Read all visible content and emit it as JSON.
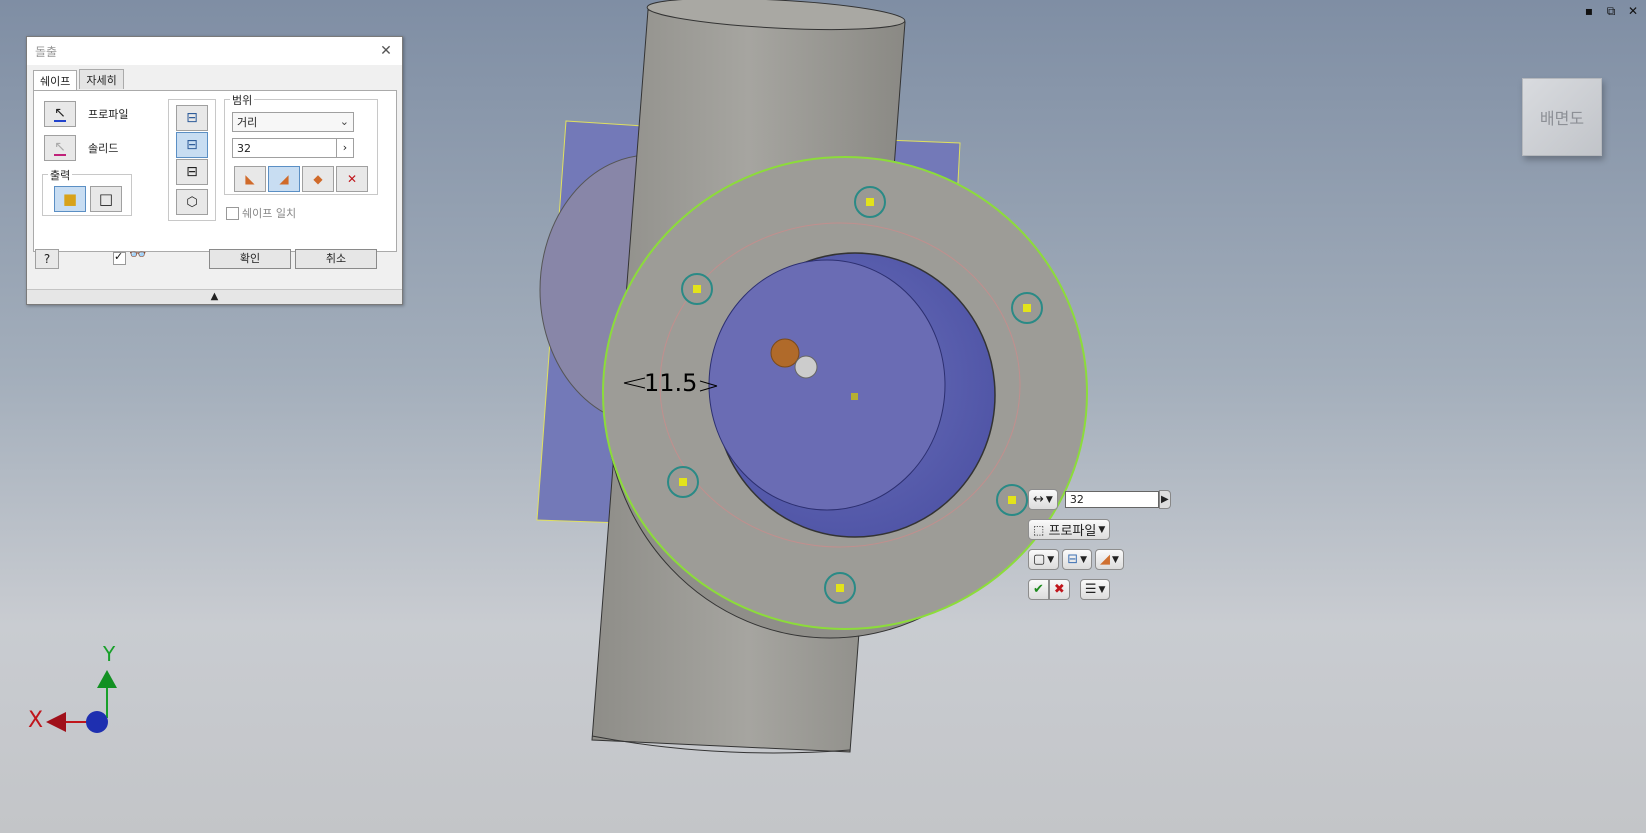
{
  "window_controls": {
    "minimize": "▪",
    "restore": "⧉",
    "close": "✕"
  },
  "dialog": {
    "title": "돌출",
    "close": "✕",
    "tabs": [
      {
        "label": "쉐이프"
      },
      {
        "label": "자세히"
      }
    ],
    "profile_label": "프로파일",
    "solid_label": "솔리드",
    "output_group": "출력",
    "extent_group": "범위",
    "extent_type": "거리",
    "distance_value": "32",
    "match_shape_label": "쉐이프 일치",
    "ok_button": "확인",
    "cancel_button": "취소",
    "expand_arrow": "▲"
  },
  "canvas": {
    "dimension_text": "11.5",
    "mini_toolbar": {
      "distance_value": "32",
      "profile_label": "프로파일"
    },
    "view_cube_label": "배면도",
    "axis_x": "X",
    "axis_y": "Y"
  },
  "colors": {
    "background_top": "#7f8ea4",
    "background_bottom": "#c3c5c8",
    "part_gray": "#9e9d98",
    "sketch_plane": "#6f78b8",
    "highlight_green": "#8cdc3a",
    "accent_blue": "#5b8fc4"
  }
}
